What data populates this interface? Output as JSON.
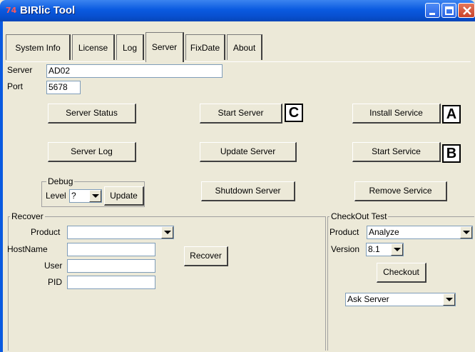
{
  "window": {
    "title": "BIRlic Tool",
    "app_icon_glyph": "74"
  },
  "tabs": [
    {
      "label": "System Info"
    },
    {
      "label": "License"
    },
    {
      "label": "Log"
    },
    {
      "label": "Server",
      "active": true
    },
    {
      "label": "FixDate"
    },
    {
      "label": "About"
    }
  ],
  "server": {
    "server_label": "Server",
    "server_value": "AD02",
    "port_label": "Port",
    "port_value": "5678"
  },
  "buttons": {
    "server_status": "Server Status",
    "start_server": "Start Server",
    "install_service": "Install Service",
    "server_log": "Server Log",
    "update_server": "Update Server",
    "start_service": "Start Service",
    "shutdown_server": "Shutdown Server",
    "remove_service": "Remove Service"
  },
  "badges": {
    "a": "A",
    "b": "B",
    "c": "C"
  },
  "debug": {
    "title": "Debug",
    "level_label": "Level",
    "level_value": "?",
    "update_label": "Update"
  },
  "recover": {
    "title": "Recover",
    "product_label": "Product",
    "product_value": "",
    "hostname_label": "HostName",
    "hostname_value": "",
    "user_label": "User",
    "user_value": "",
    "pid_label": "PID",
    "pid_value": "",
    "recover_button": "Recover"
  },
  "checkout": {
    "title": "CheckOut Test",
    "product_label": "Product",
    "product_value": "Analyze",
    "version_label": "Version",
    "version_value": "8.1",
    "checkout_button": "Checkout",
    "source_value": "Ask Server"
  },
  "colors": {
    "titlebar": "#0a5ae0",
    "client_bg": "#ece9d8",
    "badge_border": "#000000"
  }
}
